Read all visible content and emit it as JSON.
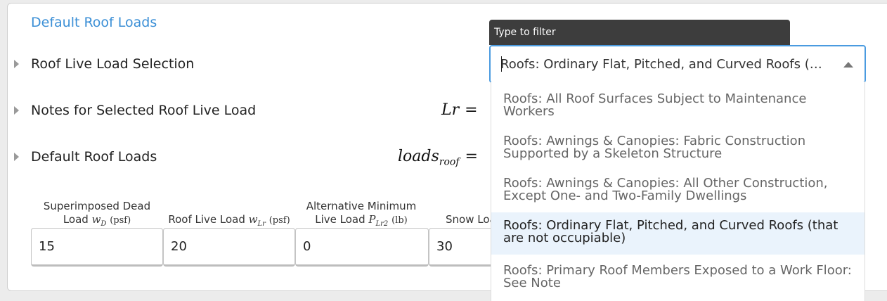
{
  "header": {
    "title": "Default Roof Loads"
  },
  "rows": [
    {
      "label": "Roof Live Load Selection"
    },
    {
      "label": "Notes for Selected Roof Live Load"
    },
    {
      "label": "Default Roof Loads"
    }
  ],
  "math": {
    "lr_symbol": "Lr",
    "loads_symbol": "loads",
    "loads_sub": "roof",
    "equals": "="
  },
  "load_table": {
    "columns": [
      {
        "line1": "Superimposed Dead",
        "line2_prefix": "Load ",
        "var": "w",
        "var_sub": "D",
        "unit": "(psf)",
        "value": "15"
      },
      {
        "line1": "",
        "line2_prefix": "Roof Live Load ",
        "var": "w",
        "var_sub": "Lr",
        "unit": "(psf)",
        "value": "20"
      },
      {
        "line1": "Alternative Minimum",
        "line2_prefix": "Live Load ",
        "var": "P",
        "var_sub": "Lr2",
        "unit": "(lb)",
        "value": "0"
      },
      {
        "line1": "",
        "line2_prefix": "Snow Loa",
        "var": "",
        "var_sub": "",
        "unit": "",
        "value": "30"
      }
    ]
  },
  "filter": {
    "tooltip": "Type to filter",
    "selected_value": "Roofs: Ordinary Flat, Pitched, and Curved Roofs (that are not occupiable)",
    "options": [
      {
        "line1": "Roofs: All Roof Surfaces Subject to Maintenance",
        "line2": "Workers",
        "selected": false
      },
      {
        "line1": "Roofs: Awnings & Canopies: Fabric Construction",
        "line2": "Supported by a Skeleton Structure",
        "selected": false
      },
      {
        "line1": "Roofs: Awnings & Canopies: All Other Construction,",
        "line2": "Except One- and Two-Family Dwellings",
        "selected": false
      },
      {
        "line1": "Roofs: Ordinary Flat, Pitched, and Curved Roofs (that",
        "line2": "are not occupiable)",
        "selected": true
      },
      {
        "line1": "Roofs: Primary Roof Members Exposed to a Work Floor:",
        "line2": "See Note",
        "selected": false
      }
    ]
  },
  "colors": {
    "link": "#3b8fd6",
    "focus": "#4a9be0",
    "selected_bg": "#eaf3fc",
    "tooltip_bg": "#3d3d3d"
  }
}
